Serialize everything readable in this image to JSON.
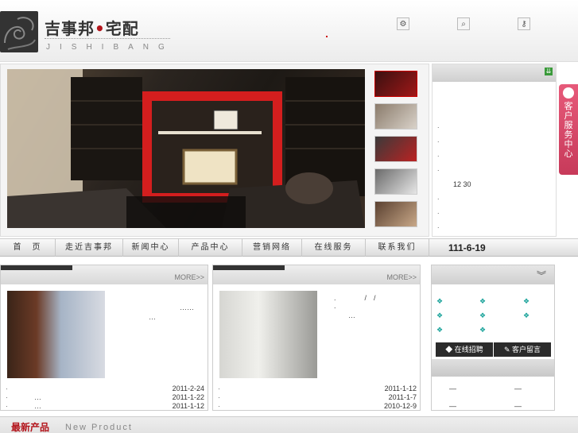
{
  "header": {
    "logo_cn_a": "吉事邦",
    "logo_dot": "•",
    "logo_cn_b": "宅配",
    "logo_en": "JISHIBANG",
    "icons": [
      "gear-icon",
      "search-icon",
      "key-icon"
    ]
  },
  "banner": {
    "thumb_count": 5
  },
  "right_panel": {
    "time_text": "12 30",
    "bullet": "."
  },
  "service_tab": {
    "label": "客户服务中心"
  },
  "nav": {
    "items": [
      "首　页",
      "走近吉事邦",
      "新闻中心",
      "产品中心",
      "营销网络",
      "在线服务",
      "联系我们"
    ],
    "date": "111-6-19"
  },
  "box_left": {
    "more": "MORE>>",
    "text1": "……",
    "text2": "…",
    "rows": [
      {
        "bullet": "·",
        "text": "",
        "date": "2011-2-24"
      },
      {
        "bullet": "·",
        "text": "…",
        "date": "2011-1-22"
      },
      {
        "bullet": "·",
        "text": "…",
        "date": "2011-1-12"
      }
    ]
  },
  "box_right": {
    "more": "MORE>>",
    "text1": ".　　　　/　/",
    "text2": ".",
    "text3": "…",
    "rows": [
      {
        "bullet": "·",
        "text": "",
        "date": "2011-1-12"
      },
      {
        "bullet": "·",
        "text": "",
        "date": "2011-1-7"
      },
      {
        "bullet": "·",
        "text": "",
        "date": "2010-12-9"
      }
    ]
  },
  "lower_right": {
    "btn_recruit": "在线招聘",
    "btn_message": "客户留言",
    "dash": "—"
  },
  "new_product": {
    "cn": "最新产品",
    "en": "New Product"
  },
  "colors": {
    "brand_red": "#b3141b",
    "accent_teal": "#1aa39a",
    "service_pink": "#d94a6a"
  }
}
